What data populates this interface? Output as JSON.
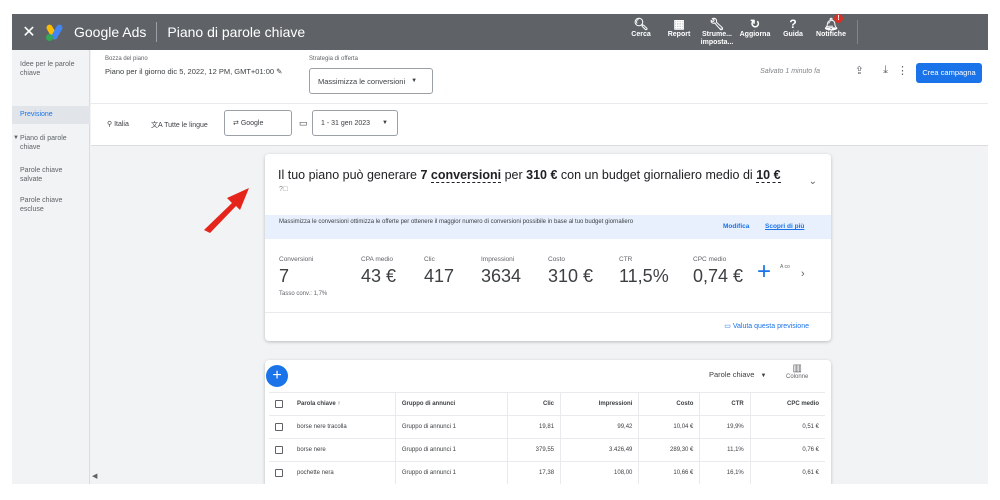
{
  "topbar": {
    "close": "✕",
    "brand": "Google Ads",
    "page_title": "Piano di parole chiave",
    "tools": [
      {
        "icon": "search-icon",
        "glyph": "🔍︎",
        "label": "Cerca"
      },
      {
        "icon": "report-icon",
        "glyph": "▦",
        "label": "Report"
      },
      {
        "icon": "wrench-icon",
        "glyph": "🔧︎",
        "label": "Strume... imposta..."
      },
      {
        "icon": "refresh-icon",
        "glyph": "↻",
        "label": "Aggiorna"
      },
      {
        "icon": "help-icon",
        "glyph": "?",
        "label": "Guida"
      },
      {
        "icon": "bell-icon",
        "glyph": "🔔︎",
        "label": "Notifiche",
        "badge": "!"
      }
    ]
  },
  "sidebar": {
    "items": [
      {
        "label": "Idee per le parole chiave"
      },
      {
        "label": "Previsione"
      },
      {
        "label": "Piano di parole chiave"
      },
      {
        "label": "Parole chiave salvate"
      },
      {
        "label": "Parole chiave escluse"
      }
    ],
    "collapse": "◀"
  },
  "header": {
    "draft_label": "Bozza del piano",
    "draft_value": "Piano per il giorno dic 5, 2022, 12 PM, GMT+01:00",
    "strategy_label": "Strategia di offerta",
    "strategy_value": "Massimizza le conversioni",
    "saved_text": "Salvato 1 minuto fa",
    "create_button": "Crea campagna",
    "location": "Italia",
    "language": "Tutte le lingue",
    "network": "Google",
    "date_range": "1 - 31 gen 2023"
  },
  "summary": {
    "prefix": "Il tuo piano può generare",
    "conversions_count": "7",
    "conversions_word": "conversioni",
    "per": "per",
    "cost": "310 €",
    "middle": "con un budget giornaliero medio di",
    "budget": "10 €",
    "info_text": "Massimizza le conversioni ottimizza le offerte per ottenere il maggior numero di conversioni possibile in base al tuo budget giornaliero",
    "modify_link": "Modifica",
    "learn_link": "Scopri di più",
    "metrics": [
      {
        "label": "Conversioni",
        "value": "7"
      },
      {
        "label": "CPA medio",
        "value": "43 €"
      },
      {
        "label": "Clic",
        "value": "417"
      },
      {
        "label": "Impressioni",
        "value": "3634"
      },
      {
        "label": "Costo",
        "value": "310 €"
      },
      {
        "label": "CTR",
        "value": "11,5%"
      },
      {
        "label": "CPC medio",
        "value": "0,74 €"
      }
    ],
    "conv_rate": "Tasso conv.: 1,7%",
    "add_metric_mini": "A\nco",
    "rate_link": "Valuta questa previsione"
  },
  "keywords": {
    "group_by": "Parole chiave",
    "columns_label": "Colonne",
    "headers": [
      "Parola chiave",
      "Gruppo di annunci",
      "Clic",
      "Impressioni",
      "Costo",
      "CTR",
      "CPC medio"
    ],
    "rows": [
      [
        "borse nere tracolla",
        "Gruppo di annunci 1",
        "19,81",
        "99,42",
        "10,04 €",
        "19,9%",
        "0,51 €"
      ],
      [
        "borse nere",
        "Gruppo di annunci 1",
        "379,55",
        "3.426,49",
        "289,30 €",
        "11,1%",
        "0,76 €"
      ],
      [
        "pochette nera",
        "Gruppo di annunci 1",
        "17,38",
        "108,00",
        "10,66 €",
        "16,1%",
        "0,61 €"
      ]
    ]
  }
}
